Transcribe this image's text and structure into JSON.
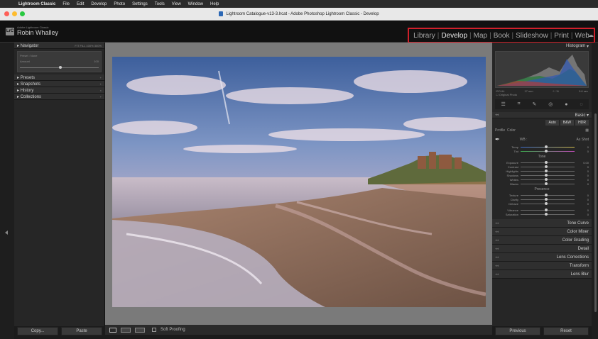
{
  "mac_menu": {
    "apple": "",
    "app_name": "Lightroom Classic",
    "items": [
      "File",
      "Edit",
      "Develop",
      "Photo",
      "Settings",
      "Tools",
      "View",
      "Window",
      "Help"
    ]
  },
  "window": {
    "title": "Lightroom Catalogue-v13-3.lrcat - Adobe Photoshop Lightroom Classic - Develop"
  },
  "identity": {
    "logo": "LrC",
    "small": "Adobe Lightroom Classic",
    "name": "Robin Whalley"
  },
  "modules": [
    "Library",
    "Develop",
    "Map",
    "Book",
    "Slideshow",
    "Print",
    "Web"
  ],
  "modules_active": "Develop",
  "left_panel": {
    "navigator": "Navigator",
    "nav_opts": "FIT  FILL  100%  300%",
    "nav_small": "Preset : None",
    "nav_amount": "Amount",
    "nav_amount_val": "100",
    "sections": [
      "Presets",
      "Snapshots",
      "History",
      "Collections"
    ],
    "copy": "Copy...",
    "paste": "Paste"
  },
  "toolbar": {
    "soft_proofing": "Soft Proofing"
  },
  "right_panel": {
    "histogram": "Histogram",
    "info": [
      "ISO 64",
      "17 mm",
      "f / 11",
      "0.6 sec"
    ],
    "original_photo": "Original Photo",
    "basic": "Basic",
    "basic_buttons": [
      "Auto",
      "B&W",
      "HDR"
    ],
    "profile_label": "Profile",
    "profile_value": "Color",
    "wb_label": "WB :",
    "wb_value": "As Shot",
    "temp": "Temp",
    "tint": "Tint",
    "tone": "Tone",
    "tone_sliders": [
      {
        "label": "Exposure",
        "value": "0.00"
      },
      {
        "label": "Contrast",
        "value": "0"
      },
      {
        "label": "Highlights",
        "value": "0"
      },
      {
        "label": "Shadows",
        "value": "0"
      },
      {
        "label": "Whites",
        "value": "0"
      },
      {
        "label": "Blacks",
        "value": "0"
      }
    ],
    "presence": "Presence",
    "presence_sliders": [
      {
        "label": "Texture",
        "value": "0"
      },
      {
        "label": "Clarity",
        "value": "0"
      },
      {
        "label": "Dehaze",
        "value": "0"
      }
    ],
    "color_sliders": [
      {
        "label": "Vibrance",
        "value": "0"
      },
      {
        "label": "Saturation",
        "value": "0"
      }
    ],
    "collapsed": [
      "Tone Curve",
      "Color Mixer",
      "Color Grading",
      "Detail",
      "Lens Corrections",
      "Transform",
      "Lens Blur"
    ],
    "previous": "Previous",
    "reset": "Reset"
  }
}
